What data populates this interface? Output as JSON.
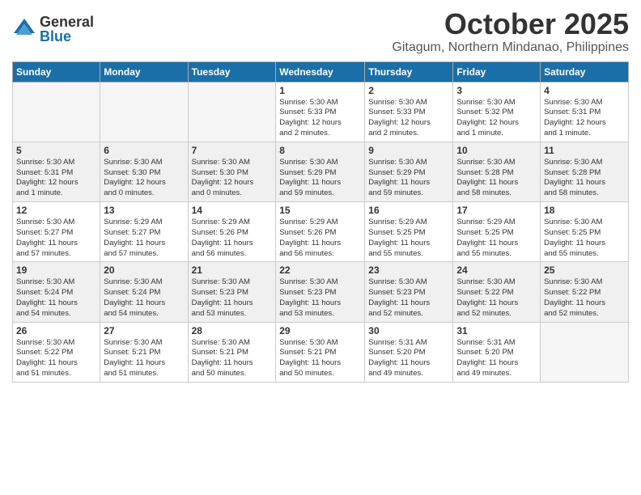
{
  "logo": {
    "general": "General",
    "blue": "Blue"
  },
  "title": "October 2025",
  "location": "Gitagum, Northern Mindanao, Philippines",
  "days_of_week": [
    "Sunday",
    "Monday",
    "Tuesday",
    "Wednesday",
    "Thursday",
    "Friday",
    "Saturday"
  ],
  "weeks": [
    {
      "shaded": false,
      "days": [
        {
          "number": "",
          "info": ""
        },
        {
          "number": "",
          "info": ""
        },
        {
          "number": "",
          "info": ""
        },
        {
          "number": "1",
          "info": "Sunrise: 5:30 AM\nSunset: 5:33 PM\nDaylight: 12 hours\nand 2 minutes."
        },
        {
          "number": "2",
          "info": "Sunrise: 5:30 AM\nSunset: 5:33 PM\nDaylight: 12 hours\nand 2 minutes."
        },
        {
          "number": "3",
          "info": "Sunrise: 5:30 AM\nSunset: 5:32 PM\nDaylight: 12 hours\nand 1 minute."
        },
        {
          "number": "4",
          "info": "Sunrise: 5:30 AM\nSunset: 5:31 PM\nDaylight: 12 hours\nand 1 minute."
        }
      ]
    },
    {
      "shaded": true,
      "days": [
        {
          "number": "5",
          "info": "Sunrise: 5:30 AM\nSunset: 5:31 PM\nDaylight: 12 hours\nand 1 minute."
        },
        {
          "number": "6",
          "info": "Sunrise: 5:30 AM\nSunset: 5:30 PM\nDaylight: 12 hours\nand 0 minutes."
        },
        {
          "number": "7",
          "info": "Sunrise: 5:30 AM\nSunset: 5:30 PM\nDaylight: 12 hours\nand 0 minutes."
        },
        {
          "number": "8",
          "info": "Sunrise: 5:30 AM\nSunset: 5:29 PM\nDaylight: 11 hours\nand 59 minutes."
        },
        {
          "number": "9",
          "info": "Sunrise: 5:30 AM\nSunset: 5:29 PM\nDaylight: 11 hours\nand 59 minutes."
        },
        {
          "number": "10",
          "info": "Sunrise: 5:30 AM\nSunset: 5:28 PM\nDaylight: 11 hours\nand 58 minutes."
        },
        {
          "number": "11",
          "info": "Sunrise: 5:30 AM\nSunset: 5:28 PM\nDaylight: 11 hours\nand 58 minutes."
        }
      ]
    },
    {
      "shaded": false,
      "days": [
        {
          "number": "12",
          "info": "Sunrise: 5:30 AM\nSunset: 5:27 PM\nDaylight: 11 hours\nand 57 minutes."
        },
        {
          "number": "13",
          "info": "Sunrise: 5:29 AM\nSunset: 5:27 PM\nDaylight: 11 hours\nand 57 minutes."
        },
        {
          "number": "14",
          "info": "Sunrise: 5:29 AM\nSunset: 5:26 PM\nDaylight: 11 hours\nand 56 minutes."
        },
        {
          "number": "15",
          "info": "Sunrise: 5:29 AM\nSunset: 5:26 PM\nDaylight: 11 hours\nand 56 minutes."
        },
        {
          "number": "16",
          "info": "Sunrise: 5:29 AM\nSunset: 5:25 PM\nDaylight: 11 hours\nand 55 minutes."
        },
        {
          "number": "17",
          "info": "Sunrise: 5:29 AM\nSunset: 5:25 PM\nDaylight: 11 hours\nand 55 minutes."
        },
        {
          "number": "18",
          "info": "Sunrise: 5:30 AM\nSunset: 5:25 PM\nDaylight: 11 hours\nand 55 minutes."
        }
      ]
    },
    {
      "shaded": true,
      "days": [
        {
          "number": "19",
          "info": "Sunrise: 5:30 AM\nSunset: 5:24 PM\nDaylight: 11 hours\nand 54 minutes."
        },
        {
          "number": "20",
          "info": "Sunrise: 5:30 AM\nSunset: 5:24 PM\nDaylight: 11 hours\nand 54 minutes."
        },
        {
          "number": "21",
          "info": "Sunrise: 5:30 AM\nSunset: 5:23 PM\nDaylight: 11 hours\nand 53 minutes."
        },
        {
          "number": "22",
          "info": "Sunrise: 5:30 AM\nSunset: 5:23 PM\nDaylight: 11 hours\nand 53 minutes."
        },
        {
          "number": "23",
          "info": "Sunrise: 5:30 AM\nSunset: 5:23 PM\nDaylight: 11 hours\nand 52 minutes."
        },
        {
          "number": "24",
          "info": "Sunrise: 5:30 AM\nSunset: 5:22 PM\nDaylight: 11 hours\nand 52 minutes."
        },
        {
          "number": "25",
          "info": "Sunrise: 5:30 AM\nSunset: 5:22 PM\nDaylight: 11 hours\nand 52 minutes."
        }
      ]
    },
    {
      "shaded": false,
      "days": [
        {
          "number": "26",
          "info": "Sunrise: 5:30 AM\nSunset: 5:22 PM\nDaylight: 11 hours\nand 51 minutes."
        },
        {
          "number": "27",
          "info": "Sunrise: 5:30 AM\nSunset: 5:21 PM\nDaylight: 11 hours\nand 51 minutes."
        },
        {
          "number": "28",
          "info": "Sunrise: 5:30 AM\nSunset: 5:21 PM\nDaylight: 11 hours\nand 50 minutes."
        },
        {
          "number": "29",
          "info": "Sunrise: 5:30 AM\nSunset: 5:21 PM\nDaylight: 11 hours\nand 50 minutes."
        },
        {
          "number": "30",
          "info": "Sunrise: 5:31 AM\nSunset: 5:20 PM\nDaylight: 11 hours\nand 49 minutes."
        },
        {
          "number": "31",
          "info": "Sunrise: 5:31 AM\nSunset: 5:20 PM\nDaylight: 11 hours\nand 49 minutes."
        },
        {
          "number": "",
          "info": ""
        }
      ]
    }
  ]
}
